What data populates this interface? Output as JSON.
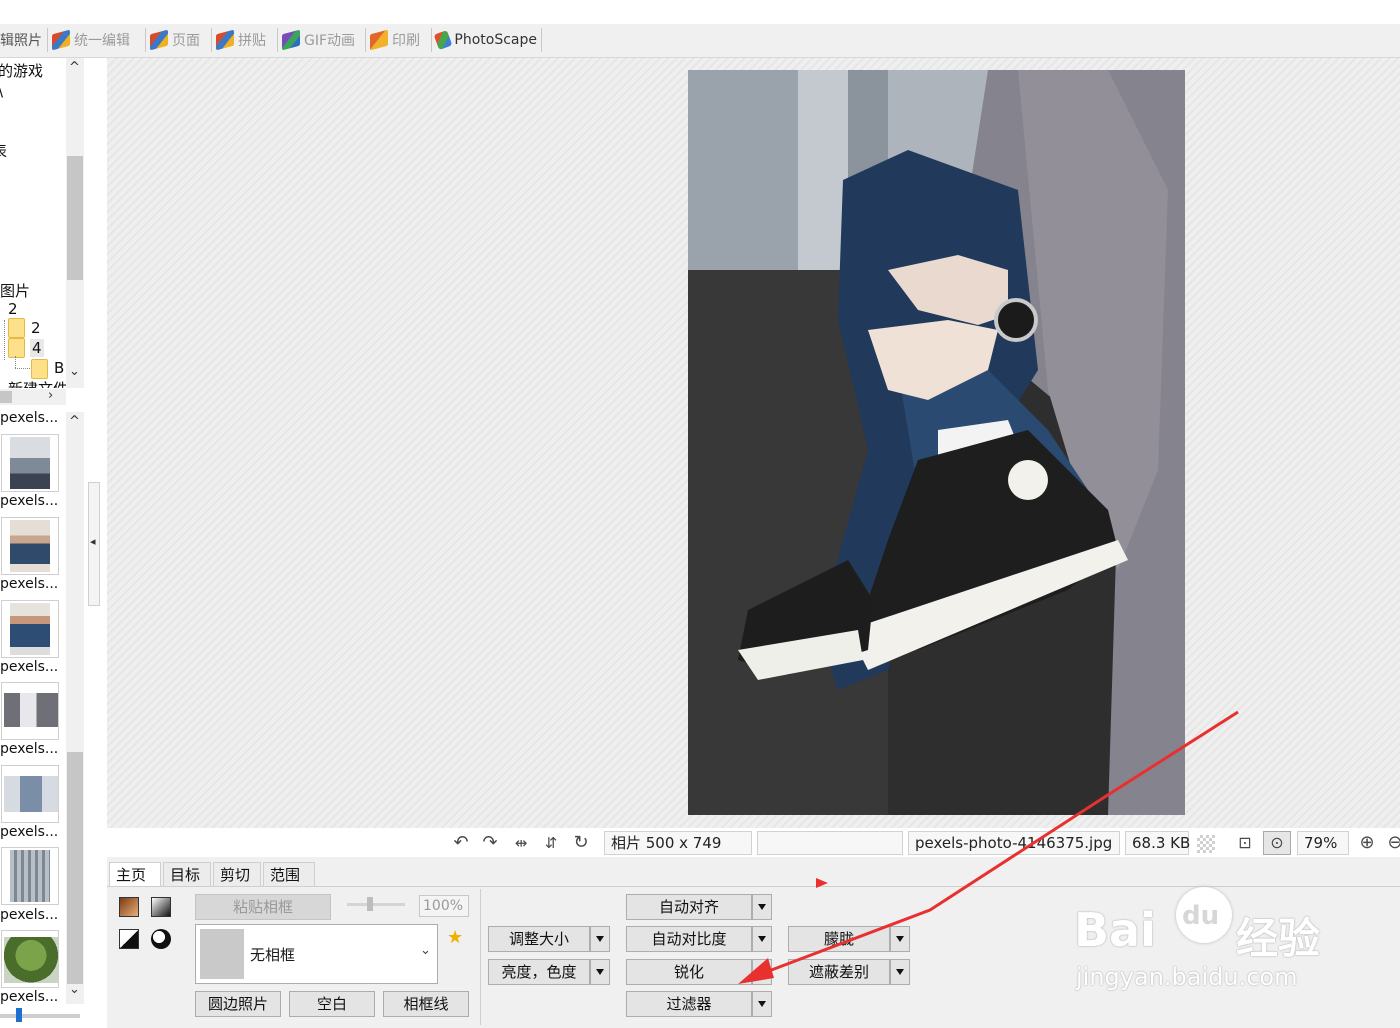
{
  "main_tabs": [
    {
      "label": "辑照片"
    },
    {
      "label": "统一编辑"
    },
    {
      "label": "页面"
    },
    {
      "label": "拼贴"
    },
    {
      "label": "GIF动画"
    },
    {
      "label": "印刷"
    },
    {
      "label": "PhotoScape"
    }
  ],
  "tree": {
    "items": [
      "的游戏",
      "\\",
      "表",
      "图片",
      "2",
      "2",
      "4",
      "B",
      "新建文件"
    ]
  },
  "thumbnails": [
    {
      "label": "pexels..."
    },
    {
      "label": "pexels..."
    },
    {
      "label": "pexels..."
    },
    {
      "label": "pexels..."
    },
    {
      "label": "pexels..."
    },
    {
      "label": "pexels..."
    },
    {
      "label": "pexels..."
    },
    {
      "label": "pexels..."
    }
  ],
  "status": {
    "photo_size": "相片 500 x 749",
    "empty_field": "",
    "filename": "pexels-photo-4146375.jpg",
    "filesize": "68.3 KB",
    "zoom": "79%"
  },
  "edit_tabs": [
    "主页",
    "目标",
    "剪切",
    "范围"
  ],
  "frame": {
    "paste_frame": "粘贴相框",
    "percent": "100%",
    "selected": "无相框",
    "round_photo": "圆边照片",
    "blank": "空白",
    "frame_line": "相框线"
  },
  "actions": {
    "resize": "调整大小",
    "brightness": "亮度，色度",
    "auto_level": "自动对齐",
    "auto_contrast": "自动对比度",
    "sharpen": "锐化",
    "filter": "过滤器",
    "blur": "朦胧",
    "backlight": "遮蔽差别"
  },
  "watermark": {
    "brand": "Bai",
    "brand2": "du",
    "brand3": "经验",
    "url": "jingyan.baidu.com"
  },
  "annotation_color": "#e8312f"
}
